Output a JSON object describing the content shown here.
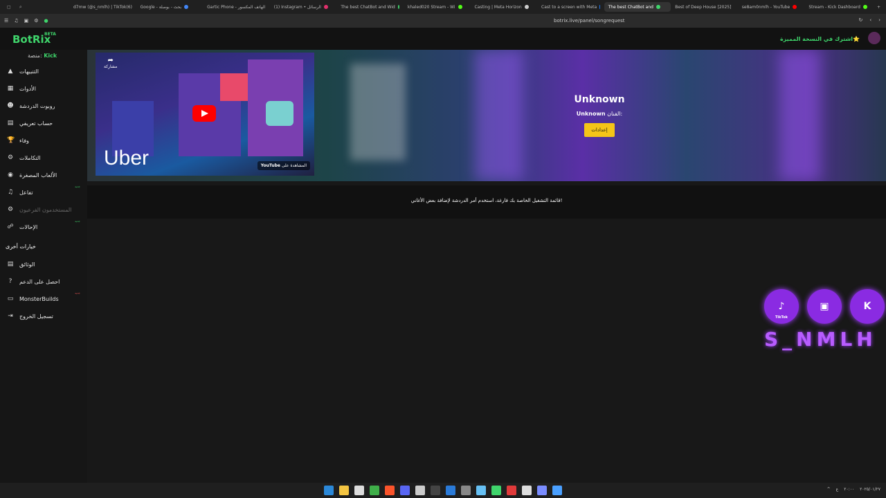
{
  "browser": {
    "tabs": [
      {
        "label": "d7mw (@s_nmlh) | TikTok(6)",
        "color": "#ffffff"
      },
      {
        "label": "Google - بحث - بوصلة",
        "color": "#4285f4"
      },
      {
        "label": "Gartic Phone - الهاتف المكسور",
        "color": "#7a5cff"
      },
      {
        "label": "(1) Instagram • الرسائل",
        "color": "#e1306c"
      },
      {
        "label": "The best ChatBot and Wid",
        "color": "#3fd46b"
      },
      {
        "label": "khaled020 Stream - Wi",
        "color": "#53fc18"
      },
      {
        "label": "Casting | Meta Horizon",
        "color": "#cccccc"
      },
      {
        "label": "Cast to a screen with Meta",
        "color": "#1877f2"
      },
      {
        "label": "The best ChatBot and",
        "color": "#3fd46b"
      },
      {
        "label": "Best of Deep House [2025]",
        "color": "#ff0000"
      },
      {
        "label": "se8am0nmlh - YouTube",
        "color": "#ff0000"
      },
      {
        "label": "Stream - Kick Dashboard",
        "color": "#53fc18"
      }
    ],
    "active_tab_index": 8,
    "url": "botrix.live/panel/songrequest"
  },
  "app": {
    "logo": "BotRix",
    "beta": "BETA",
    "premium_link": "اشترك في النسخة المميزة⭐",
    "platform_label": "منصة:",
    "platform_value": "Kick"
  },
  "sidebar": {
    "items": [
      {
        "label": "التنبيهات",
        "icon": "warning-icon",
        "glyph": "▲"
      },
      {
        "label": "الأدوات",
        "icon": "grid-icon",
        "glyph": "▦"
      },
      {
        "label": "روبوت الدردشة",
        "icon": "robot-icon",
        "glyph": "☻"
      },
      {
        "label": "حساب تعريفي",
        "icon": "id-card-icon",
        "glyph": "▤"
      },
      {
        "label": "وفاء",
        "icon": "trophy-icon",
        "glyph": "🏆"
      },
      {
        "label": "التكاملات",
        "icon": "gear-icon",
        "glyph": "⚙"
      },
      {
        "label": "الألعاب المصغرة",
        "icon": "gamepad-icon",
        "glyph": "◉"
      },
      {
        "label": "تفاعل",
        "icon": "music-icon",
        "glyph": "♫",
        "tag": "جديد"
      },
      {
        "label": "المستخدمون الفرعيون",
        "icon": "users-icon",
        "glyph": "⚙",
        "disabled": true
      },
      {
        "label": "الإحالات",
        "icon": "referral-icon",
        "glyph": "☍",
        "tag": "جديد"
      }
    ],
    "section_title": "خيارات أخرى",
    "other_items": [
      {
        "label": "الوثائق",
        "icon": "docs-icon",
        "glyph": "▤"
      },
      {
        "label": "احصل على الدعم",
        "icon": "help-icon",
        "glyph": "?"
      },
      {
        "label": "MonsterBuilds",
        "icon": "monitor-icon",
        "glyph": "▭",
        "tag": "جديد"
      },
      {
        "label": "تسجيل الخروج",
        "icon": "logout-icon",
        "glyph": "⇥"
      }
    ]
  },
  "player": {
    "video_brand": "Uber",
    "share_label": "مشاركة",
    "watch_on": "المشاهدة على",
    "youtube_label": "YouTube",
    "song_title": "Unknown",
    "artist_label": "الفنان:",
    "artist_value": "Unknown",
    "settings_button": "إعدادات"
  },
  "playlist": {
    "empty_message": "قائمة التشغيل الخاصة بك فارغة، استخدم أمر الدردشة لإضافة بعض الأغاني!"
  },
  "overlay": {
    "tiktok_label": "TikTok",
    "handle": "S_NMLH"
  },
  "taskbar": {
    "icons": [
      {
        "name": "windows-icon",
        "color": "#2b88d8"
      },
      {
        "name": "folder-icon",
        "color": "#f4c542"
      },
      {
        "name": "calendar-icon",
        "color": "#dddddd"
      },
      {
        "name": "files-icon",
        "color": "#3fae49"
      },
      {
        "name": "brave-icon",
        "color": "#fb542b"
      },
      {
        "name": "discord-icon",
        "color": "#5865f2"
      },
      {
        "name": "vr-icon",
        "color": "#cccccc"
      },
      {
        "name": "obs-icon",
        "color": "#444444"
      },
      {
        "name": "app-icon",
        "color": "#2a7ad8"
      },
      {
        "name": "app2-icon",
        "color": "#888888"
      },
      {
        "name": "steam-icon",
        "color": "#66c0f4"
      },
      {
        "name": "lock-icon",
        "color": "#3fd46b"
      },
      {
        "name": "record-icon",
        "color": "#e03a3a"
      },
      {
        "name": "settings-icon",
        "color": "#dddddd"
      },
      {
        "name": "diamond-icon",
        "color": "#7a8cff"
      },
      {
        "name": "blue-icon",
        "color": "#4aa0ff"
      }
    ],
    "tray": [
      "^",
      "ع",
      "٢٠:٠٠",
      "٢٠٢٥/٠١/٢٧"
    ]
  }
}
